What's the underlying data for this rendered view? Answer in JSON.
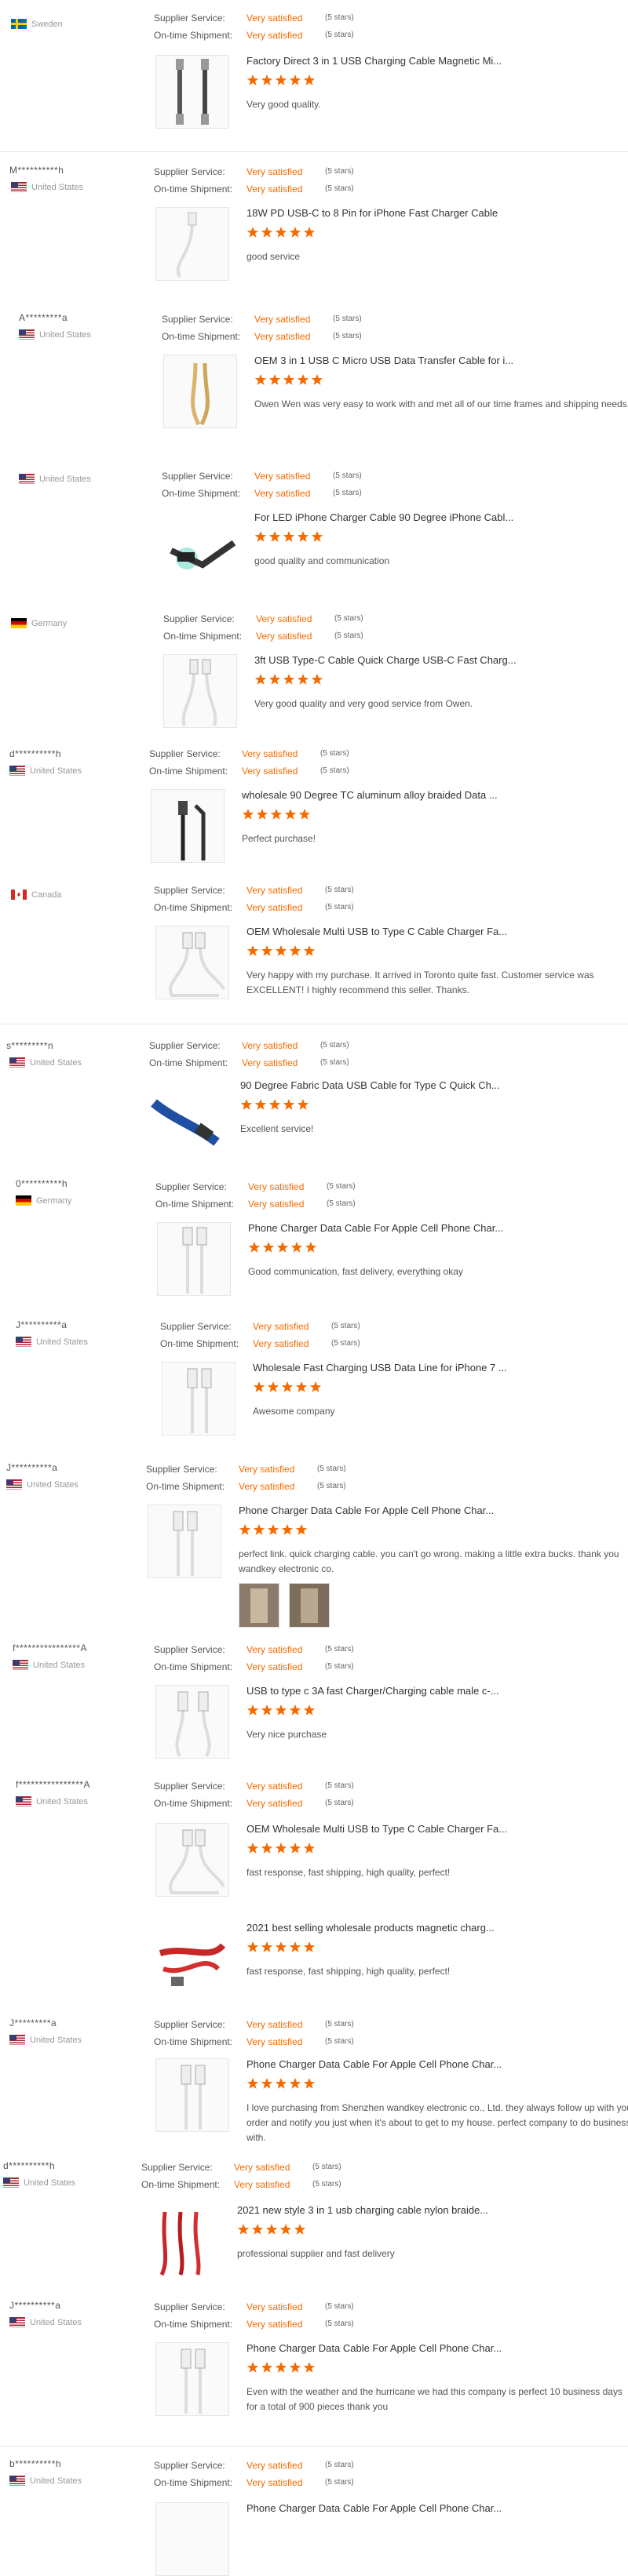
{
  "labels": {
    "supplier": "Supplier Service:",
    "shipment": "On-time Shipment:"
  },
  "colors": {
    "accent": "#f56b00",
    "star": "#f56b00",
    "divider": "#e5e5e5"
  },
  "reviews": [
    {
      "name": "",
      "country": "Sweden",
      "flag": "se",
      "supplier": "Very satisfied",
      "supplier_stars": "(5 stars)",
      "shipment": "Very satisfied",
      "shipment_stars": "(5 stars)",
      "title": "Factory Direct 3 in 1 USB Charging Cable Magnetic Mi...",
      "rating": 5,
      "comment": "Very good quality.",
      "thumb": "braided3",
      "images": 0
    },
    {
      "name": "M**********h",
      "country": "United States",
      "flag": "us",
      "supplier": "Very satisfied",
      "supplier_stars": "(5 stars)",
      "shipment": "Very satisfied",
      "shipment_stars": "(5 stars)",
      "title": "18W PD USB-C to 8 Pin for iPhone Fast Charger Cable",
      "rating": 5,
      "comment": "good service",
      "thumb": "white",
      "images": 0
    },
    {
      "name": "A*********a",
      "country": "United States",
      "flag": "us",
      "supplier": "Very satisfied",
      "supplier_stars": "(5 stars)",
      "shipment": "Very satisfied",
      "shipment_stars": "(5 stars)",
      "title": "OEM 3 in 1 USB C Micro USB Data Transfer Cable for i...",
      "rating": 5,
      "comment": "Owen Wen was very easy to work with and met all of our time frames and shipping needs.",
      "thumb": "gold",
      "images": 0
    },
    {
      "name": "",
      "country": "United States",
      "flag": "us",
      "supplier": "Very satisfied",
      "supplier_stars": "(5 stars)",
      "shipment": "Very satisfied",
      "shipment_stars": "(5 stars)",
      "title": "For LED iPhone Charger Cable 90 Degree iPhone Cabl...",
      "rating": 5,
      "comment": "good quality and communication",
      "thumb": "angleblack",
      "images": 0
    },
    {
      "name": "",
      "country": "Germany",
      "flag": "de",
      "supplier": "Very satisfied",
      "supplier_stars": "(5 stars)",
      "shipment": "Very satisfied",
      "shipment_stars": "(5 stars)",
      "title": "3ft USB Type-C Cable Quick Charge USB-C Fast Charg...",
      "rating": 5,
      "comment": "Very good quality and very good service from Owen.",
      "thumb": "white",
      "images": 0
    },
    {
      "name": "d**********h",
      "country": "United States",
      "flag": "us",
      "supplier": "Very satisfied",
      "supplier_stars": "(5 stars)",
      "shipment": "Very satisfied",
      "shipment_stars": "(5 stars)",
      "title": "wholesale 90 Degree TC aluminum alloy braided Data ...",
      "rating": 5,
      "comment": "Perfect purchase!",
      "thumb": "black",
      "images": 0
    },
    {
      "name": "",
      "country": "Canada",
      "flag": "ca",
      "supplier": "Very satisfied",
      "supplier_stars": "(5 stars)",
      "shipment": "Very satisfied",
      "shipment_stars": "(5 stars)",
      "title": "OEM Wholesale Multi USB to Type C Cable Charger Fa...",
      "rating": 5,
      "comment": "Very happy with my purchase. It arrived in Toronto quite fast. Customer service was EXCELLENT! I highly recommend this seller. Thanks.",
      "thumb": "white",
      "images": 0
    },
    {
      "name": "s*********n",
      "country": "United States",
      "flag": "us",
      "supplier": "Very satisfied",
      "supplier_stars": "(5 stars)",
      "shipment": "Very satisfied",
      "shipment_stars": "(5 stars)",
      "title": "90 Degree Fabric Data USB Cable for Type C Quick Ch...",
      "rating": 5,
      "comment": "Excellent service!",
      "thumb": "blue",
      "images": 0
    },
    {
      "name": "0**********h",
      "country": "Germany",
      "flag": "de",
      "supplier": "Very satisfied",
      "supplier_stars": "(5 stars)",
      "shipment": "Very satisfied",
      "shipment_stars": "(5 stars)",
      "title": "Phone Charger Data Cable For Apple Cell Phone Char...",
      "rating": 5,
      "comment": "Good communication, fast delivery, everything okay",
      "thumb": "white",
      "images": 0
    },
    {
      "name": "J**********a",
      "country": "United States",
      "flag": "us",
      "supplier": "Very satisfied",
      "supplier_stars": "(5 stars)",
      "shipment": "Very satisfied",
      "shipment_stars": "(5 stars)",
      "title": "Wholesale Fast Charging USB Data Line for iPhone 7 ...",
      "rating": 5,
      "comment": "Awesome company",
      "thumb": "white",
      "images": 0
    },
    {
      "name": "J**********a",
      "country": "United States",
      "flag": "us",
      "supplier": "Very satisfied",
      "supplier_stars": "(5 stars)",
      "shipment": "Very satisfied",
      "shipment_stars": "(5 stars)",
      "title": "Phone Charger Data Cable For Apple Cell Phone Char...",
      "rating": 5,
      "comment": "perfect link. quick charging cable. you can't go wrong. making a little extra bucks. thank you wandkey electronic co.",
      "thumb": "white",
      "images": 2
    },
    {
      "name": "f****************A",
      "country": "United States",
      "flag": "us",
      "supplier": "Very satisfied",
      "supplier_stars": "(5 stars)",
      "shipment": "Very satisfied",
      "shipment_stars": "(5 stars)",
      "title": "USB to type c 3A fast Charger/Charging cable male c-...",
      "rating": 5,
      "comment": "Very nice purchase",
      "thumb": "white",
      "images": 0
    },
    {
      "name": "f****************A",
      "country": "United States",
      "flag": "us",
      "supplier": "Very satisfied",
      "supplier_stars": "(5 stars)",
      "shipment": "Very satisfied",
      "shipment_stars": "(5 stars)",
      "title": "OEM Wholesale Multi USB to Type C Cable Charger Fa...",
      "rating": 5,
      "comment": "fast response, fast shipping, high quality, perfect!",
      "thumb": "white",
      "images": 0
    },
    {
      "name": "",
      "country": "",
      "flag": "",
      "supplier": "",
      "supplier_stars": "",
      "shipment": "",
      "shipment_stars": "",
      "title": "2021 best selling wholesale products magnetic charg...",
      "rating": 5,
      "comment": "fast response, fast shipping, high quality, perfect!",
      "thumb": "red",
      "images": 0
    },
    {
      "name": "J*********a",
      "country": "United States",
      "flag": "us",
      "supplier": "Very satisfied",
      "supplier_stars": "(5 stars)",
      "shipment": "Very satisfied",
      "shipment_stars": "(5 stars)",
      "title": "Phone Charger Data Cable For Apple Cell Phone Char...",
      "rating": 5,
      "comment": "I love purchasing from Shenzhen wandkey electronic co., Ltd. they always follow up with your order and notify you just when it's about to get to my house. perfect company to do business with.",
      "thumb": "white",
      "images": 0
    },
    {
      "name": "d**********h",
      "country": "United States",
      "flag": "us",
      "supplier": "Very satisfied",
      "supplier_stars": "(5 stars)",
      "shipment": "Very satisfied",
      "shipment_stars": "(5 stars)",
      "title": "2021 new style 3 in 1 usb charging cable nylon braide...",
      "rating": 5,
      "comment": "professional supplier and fast delivery",
      "thumb": "red3",
      "images": 0
    },
    {
      "name": "J**********a",
      "country": "United States",
      "flag": "us",
      "supplier": "Very satisfied",
      "supplier_stars": "(5 stars)",
      "shipment": "Very satisfied",
      "shipment_stars": "(5 stars)",
      "title": "Phone Charger Data Cable For Apple Cell Phone Char...",
      "rating": 5,
      "comment": "Even with the weather and the hurricane we had this company is perfect 10 business days for a total of 900 pieces thank you",
      "thumb": "white",
      "images": 0
    },
    {
      "name": "b**********h",
      "country": "United States",
      "flag": "us",
      "supplier": "Very satisfied",
      "supplier_stars": "(5 stars)",
      "shipment": "Very satisfied",
      "shipment_stars": "(5 stars)",
      "title": "Phone Charger Data Cable For Apple Cell Phone Char...",
      "rating": 5,
      "comment": "",
      "thumb": "white",
      "images": 0
    }
  ]
}
